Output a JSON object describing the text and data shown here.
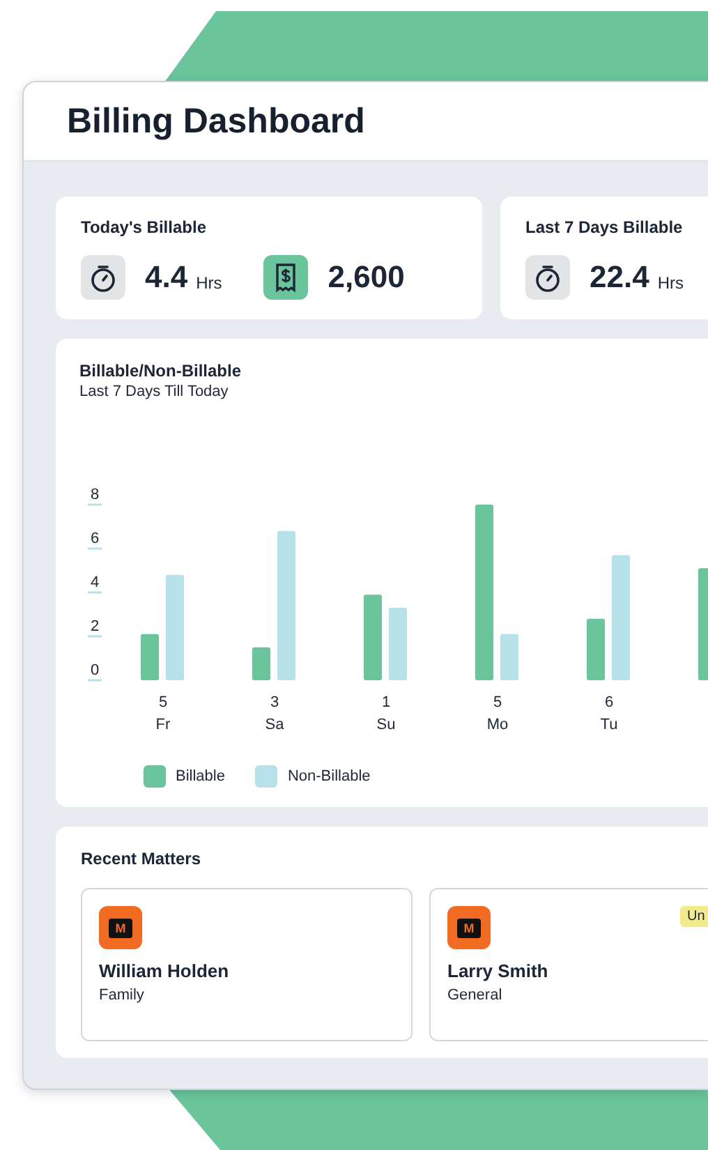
{
  "window": {
    "title": "Billing Dashboard"
  },
  "stats": [
    {
      "title": "Today's Billable",
      "items": [
        {
          "kind": "time",
          "value": "4.4",
          "unit": "Hrs"
        },
        {
          "kind": "money",
          "value": "2,600"
        }
      ]
    },
    {
      "title": "Last 7 Days Billable",
      "items": [
        {
          "kind": "time",
          "value": "22.4",
          "unit": "Hrs"
        }
      ]
    }
  ],
  "chart": {
    "title": "Billable/Non-Billable",
    "subtitle": "Last 7 Days Till Today",
    "dates": [
      "5",
      "3",
      "1",
      "5",
      "6"
    ],
    "chart_data": {
      "type": "bar",
      "categories": [
        "Fr",
        "Sa",
        "Su",
        "Mo",
        "Tu",
        null
      ],
      "ylim": [
        0,
        8
      ],
      "yticks": [
        0,
        2,
        4,
        6,
        8
      ],
      "series": [
        {
          "name": "Billable",
          "color": "#6ac49c",
          "values": [
            2.1,
            1.5,
            3.9,
            8,
            2.8,
            5.1
          ]
        },
        {
          "name": "Non-Billable",
          "color": "#b7e1ea",
          "values": [
            4.8,
            6.8,
            3.3,
            2.1,
            5.7,
            null
          ]
        }
      ]
    }
  },
  "recent_matters": {
    "title": "Recent Matters",
    "items": [
      {
        "icon_letter": "M",
        "name": "William Holden",
        "type": "Family"
      },
      {
        "icon_letter": "M",
        "name": "Larry Smith",
        "type": "General",
        "badge": "Un"
      }
    ]
  }
}
